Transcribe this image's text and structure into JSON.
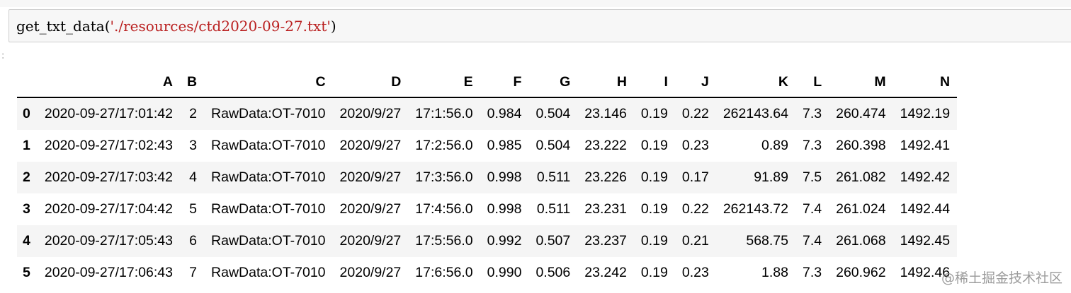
{
  "code_cell": {
    "func": "get_txt_data(",
    "arg": "'./resources/ctd2020-09-27.txt'",
    "close": ")"
  },
  "prompt": ":",
  "table": {
    "columns": [
      "",
      "A",
      "B",
      "C",
      "D",
      "E",
      "F",
      "G",
      "H",
      "I",
      "J",
      "K",
      "L",
      "M",
      "N"
    ],
    "rows": [
      {
        "index": "0",
        "cells": [
          "2020-09-27/17:01:42",
          "2",
          "RawData:OT-7010",
          "2020/9/27",
          "17:1:56.0",
          "0.984",
          "0.504",
          "23.146",
          "0.19",
          "0.22",
          "262143.64",
          "7.3",
          "260.474",
          "1492.19"
        ]
      },
      {
        "index": "1",
        "cells": [
          "2020-09-27/17:02:43",
          "3",
          "RawData:OT-7010",
          "2020/9/27",
          "17:2:56.0",
          "0.985",
          "0.504",
          "23.222",
          "0.19",
          "0.23",
          "0.89",
          "7.3",
          "260.398",
          "1492.41"
        ]
      },
      {
        "index": "2",
        "cells": [
          "2020-09-27/17:03:42",
          "4",
          "RawData:OT-7010",
          "2020/9/27",
          "17:3:56.0",
          "0.998",
          "0.511",
          "23.226",
          "0.19",
          "0.17",
          "91.89",
          "7.5",
          "261.082",
          "1492.42"
        ]
      },
      {
        "index": "3",
        "cells": [
          "2020-09-27/17:04:42",
          "5",
          "RawData:OT-7010",
          "2020/9/27",
          "17:4:56.0",
          "0.998",
          "0.511",
          "23.231",
          "0.19",
          "0.22",
          "262143.72",
          "7.4",
          "261.024",
          "1492.44"
        ]
      },
      {
        "index": "4",
        "cells": [
          "2020-09-27/17:05:43",
          "6",
          "RawData:OT-7010",
          "2020/9/27",
          "17:5:56.0",
          "0.992",
          "0.507",
          "23.237",
          "0.19",
          "0.21",
          "568.75",
          "7.4",
          "261.068",
          "1492.45"
        ]
      },
      {
        "index": "5",
        "cells": [
          "2020-09-27/17:06:43",
          "7",
          "RawData:OT-7010",
          "2020/9/27",
          "17:6:56.0",
          "0.990",
          "0.506",
          "23.242",
          "0.19",
          "0.23",
          "1.88",
          "7.3",
          "260.962",
          "1492.46"
        ]
      }
    ]
  },
  "watermark": "@稀土掘金技术社区"
}
